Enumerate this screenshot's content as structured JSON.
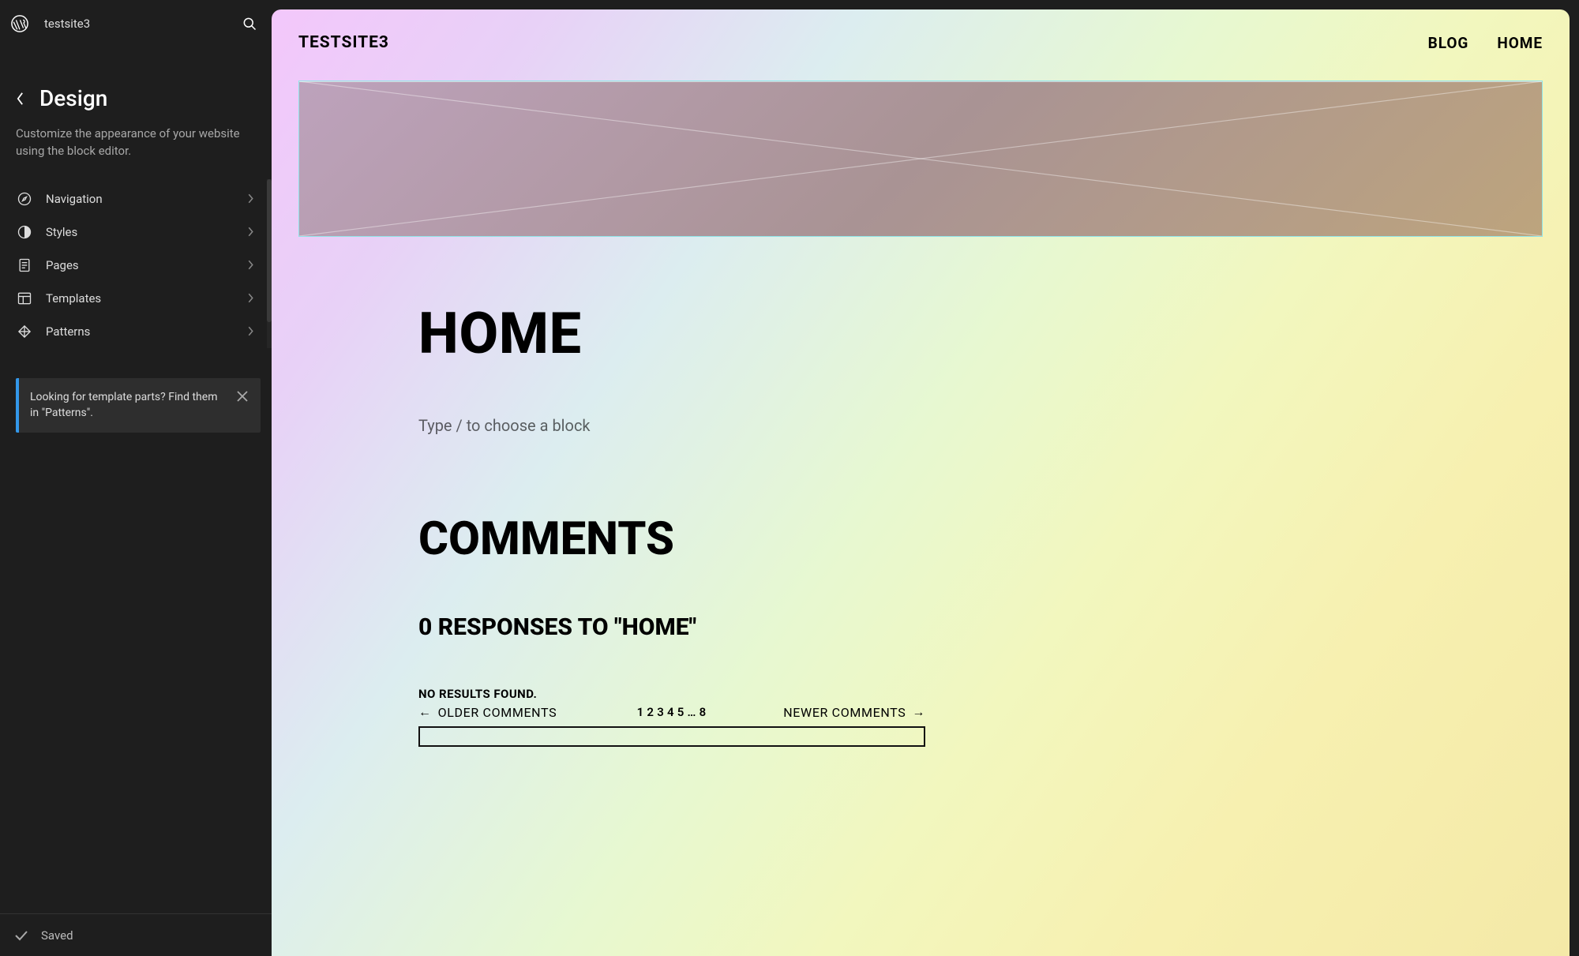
{
  "app": {
    "site_name": "testsite3"
  },
  "sidebar": {
    "title": "Design",
    "description": "Customize the appearance of your website using the block editor.",
    "items": [
      {
        "icon": "compass-icon",
        "label": "Navigation"
      },
      {
        "icon": "contrast-icon",
        "label": "Styles"
      },
      {
        "icon": "page-icon",
        "label": "Pages"
      },
      {
        "icon": "layout-icon",
        "label": "Templates"
      },
      {
        "icon": "diamond-icon",
        "label": "Patterns"
      }
    ],
    "hint": "Looking for template parts? Find them in \"Patterns\".",
    "footer_status": "Saved"
  },
  "preview": {
    "site_title": "TESTSITE3",
    "nav": [
      "BLOG",
      "HOME"
    ],
    "page_title": "HOME",
    "placeholder": "Type / to choose a block",
    "comments_heading": "COMMENTS",
    "responses_heading": "0 RESPONSES TO \"HOME\"",
    "no_results": "NO RESULTS FOUND.",
    "older_label": "OLDER COMMENTS",
    "newer_label": "NEWER COMMENTS",
    "page_numbers": [
      "1",
      "2",
      "3",
      "4",
      "5",
      "…",
      "8"
    ]
  }
}
